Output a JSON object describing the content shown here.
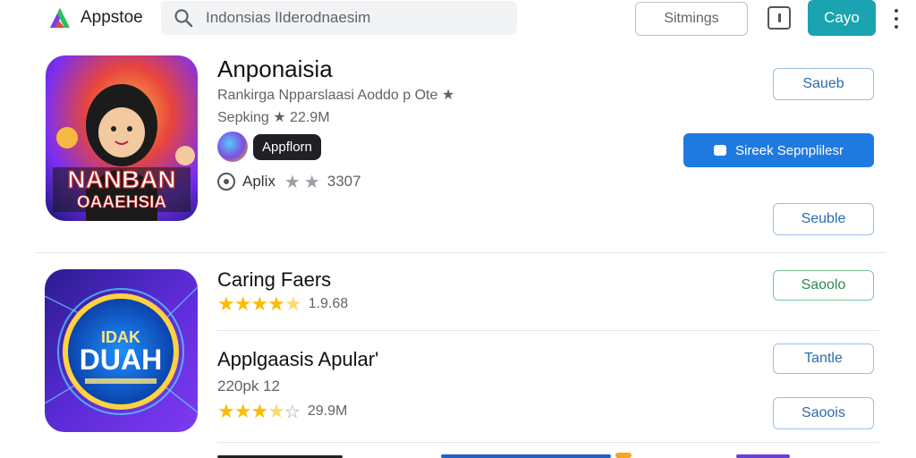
{
  "header": {
    "logo_text": "Appstoe",
    "search_placeholder": "Indonsias lIderodnaesim",
    "settings_label": "Sitmings",
    "primary_label": "Cayo",
    "colors": {
      "primary": "#1aa3b0",
      "search_bg": "#f1f3f4"
    }
  },
  "app1": {
    "title": "Anponaisia",
    "line1": "Rankirga Npparslaasi Aoddo p Ote ★",
    "line2": "Sepking ★ 22.9M",
    "chip": "Appflorn",
    "aplix_label": "Aplix",
    "aplix_num": "3307",
    "icon_text_top": "NANBAN",
    "icon_text_bottom": "OAAEHSIA",
    "buttons": {
      "top": "Saueb",
      "blue": "Sireek Sepnplilesr",
      "bottom": "Seuble"
    }
  },
  "app2": {
    "title": "Caring Faers",
    "rating_num": "1.9.68",
    "subtitle": "Applgaasis Apular'",
    "line_small": "220pk  12",
    "rating2_num": "29.9M",
    "icon_text_top": "IDAK",
    "icon_text_mid": "DUAH",
    "buttons": {
      "green": "Saoolo",
      "tantle": "Tantle",
      "saools": "Saoois"
    }
  }
}
